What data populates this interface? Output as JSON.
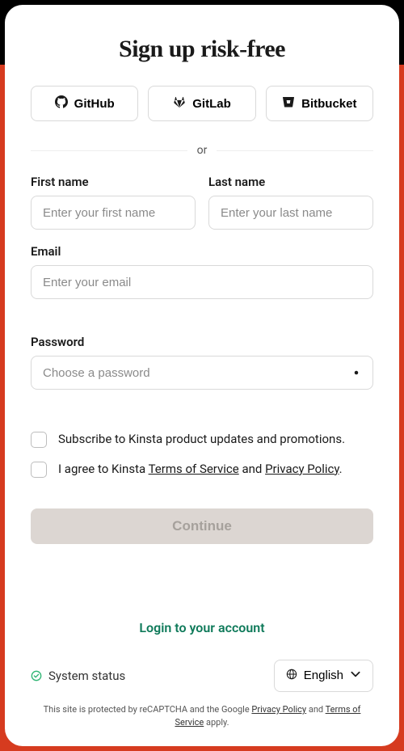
{
  "title": "Sign up risk-free",
  "oauth": {
    "github": "GitHub",
    "gitlab": "GitLab",
    "bitbucket": "Bitbucket"
  },
  "divider": "or",
  "fields": {
    "first_name": {
      "label": "First name",
      "placeholder": "Enter your first name"
    },
    "last_name": {
      "label": "Last name",
      "placeholder": "Enter your last name"
    },
    "email": {
      "label": "Email",
      "placeholder": "Enter your email"
    },
    "password": {
      "label": "Password",
      "placeholder": "Choose a password"
    }
  },
  "checkboxes": {
    "subscribe": "Subscribe to Kinsta product updates and promotions.",
    "agree_prefix": "I agree to Kinsta ",
    "tos": "Terms of Service",
    "agree_mid": " and ",
    "privacy": "Privacy Policy",
    "agree_suffix": "."
  },
  "continue": "Continue",
  "login_link": "Login to your account",
  "status_label": "System status",
  "language": "English",
  "recaptcha": {
    "prefix": "This site is protected by reCAPTCHA and the Google ",
    "privacy": "Privacy Policy",
    "mid": " and ",
    "tos": "Terms of Service",
    "suffix": " apply."
  }
}
